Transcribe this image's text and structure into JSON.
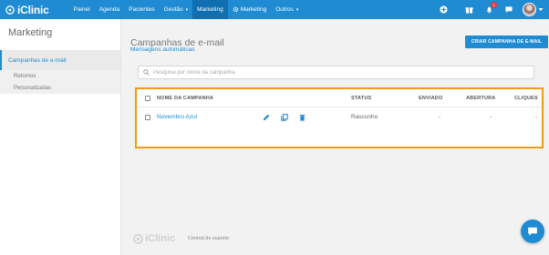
{
  "brand": {
    "name": "iClinic",
    "color": "#1e8bd2",
    "highlight": "#f39c12"
  },
  "topnav": {
    "items": [
      {
        "label": "Painel"
      },
      {
        "label": "Agenda"
      },
      {
        "label": "Pacientes"
      },
      {
        "label": "Gestão",
        "caret": "▾"
      },
      {
        "label": "Marketing",
        "active": true
      },
      {
        "label": "Marketing",
        "icon": "gear-icon"
      },
      {
        "label": "Outros",
        "caret": "▾"
      }
    ],
    "notification_count": "1",
    "icons": [
      "add-circle-icon",
      "gift-icon",
      "bell-icon",
      "chat-bubble-icon",
      "avatar"
    ]
  },
  "sidebar": {
    "title": "Marketing",
    "items": [
      {
        "label": "Campanhas de e-mail",
        "active": true
      },
      {
        "label": "Mensagens automáticas"
      }
    ],
    "subitems": [
      {
        "label": "Retornos"
      },
      {
        "label": "Personalizadas"
      }
    ]
  },
  "main": {
    "title": "Campanhas de e-mail",
    "create_button": "CRIAR CAMPANHA DE E-MAIL",
    "search_placeholder": "Pesquise por nome da campanha",
    "table": {
      "headers": {
        "name": "NOME DA CAMPANHA",
        "status": "STATUS",
        "sent": "ENVIADO",
        "opened": "ABERTURA",
        "clicks": "CLIQUES"
      },
      "rows": [
        {
          "name": "Novembro Azul",
          "status": "Rascunho",
          "sent": "-",
          "opened": "-",
          "clicks": "-"
        }
      ]
    }
  },
  "footer": {
    "logo": "iClinic",
    "support_link": "Central de suporte"
  }
}
